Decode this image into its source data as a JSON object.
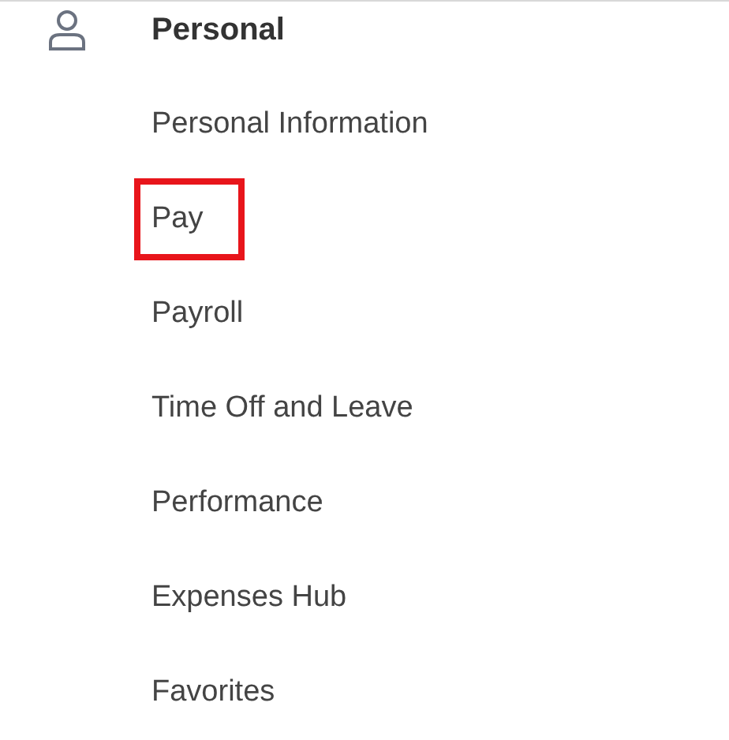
{
  "section": {
    "title": "Personal"
  },
  "items": [
    {
      "label": "Personal Information",
      "highlighted": false
    },
    {
      "label": "Pay",
      "highlighted": true
    },
    {
      "label": "Payroll",
      "highlighted": false
    },
    {
      "label": "Time Off and Leave",
      "highlighted": false
    },
    {
      "label": "Performance",
      "highlighted": false
    },
    {
      "label": "Expenses Hub",
      "highlighted": false
    },
    {
      "label": "Favorites",
      "highlighted": false
    }
  ]
}
